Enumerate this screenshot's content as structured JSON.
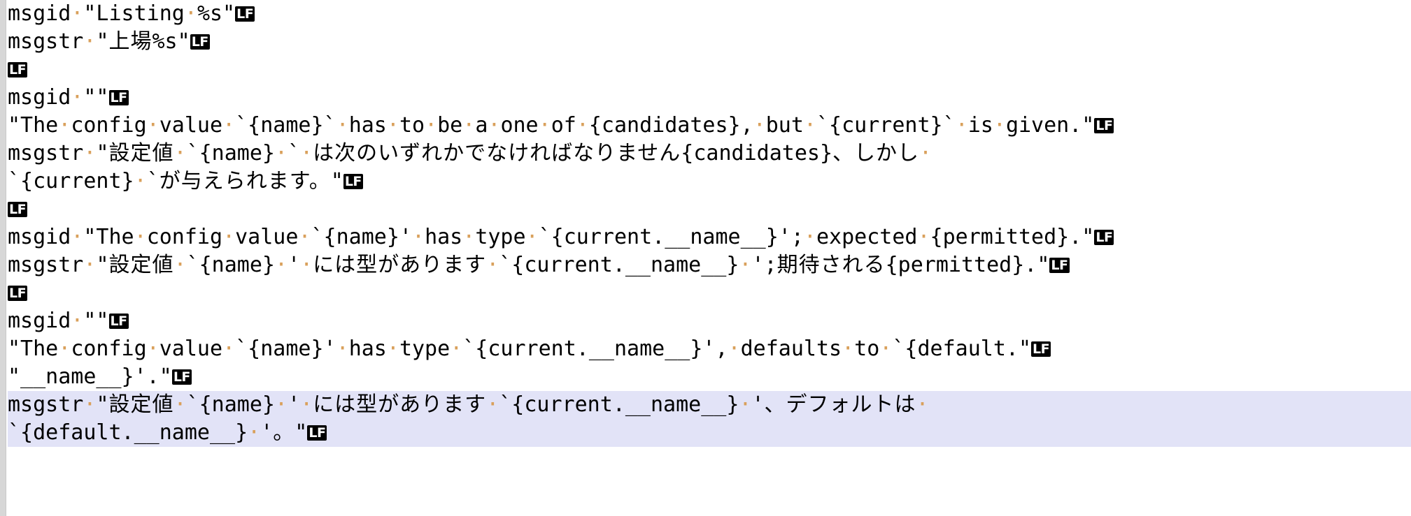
{
  "editor": {
    "file_type": "gettext-po",
    "show_whitespace": true,
    "eol_marker_label": "LF",
    "space_marker_glyph": "·",
    "selection_color": "#e2e3f7",
    "gutter_color": "#d7d7d7",
    "background_color": "#ffffff",
    "text_color": "#000000",
    "whitespace_dot_color": "#d9a05b",
    "eol_badge_bg": "#000000",
    "eol_badge_fg": "#ffffff"
  },
  "lines": [
    {
      "id": 1,
      "selected": false,
      "eol": "LF",
      "text": "msgid \"Listing %s\"",
      "segments": [
        {
          "type": "text",
          "value": "msgid"
        },
        {
          "type": "space"
        },
        {
          "type": "text",
          "value": "\"Listing"
        },
        {
          "type": "space"
        },
        {
          "type": "text",
          "value": "%s\""
        }
      ]
    },
    {
      "id": 2,
      "selected": false,
      "eol": "LF",
      "text": "msgstr \"上場%s\"",
      "segments": [
        {
          "type": "text",
          "value": "msgstr"
        },
        {
          "type": "space"
        },
        {
          "type": "text",
          "value": "\""
        },
        {
          "type": "jp",
          "value": "上場"
        },
        {
          "type": "text",
          "value": "%s\""
        }
      ]
    },
    {
      "id": 3,
      "selected": false,
      "eol": "LF",
      "text": "",
      "segments": []
    },
    {
      "id": 4,
      "selected": false,
      "eol": "LF",
      "text": "msgid \"\"",
      "segments": [
        {
          "type": "text",
          "value": "msgid"
        },
        {
          "type": "space"
        },
        {
          "type": "text",
          "value": "\"\""
        }
      ]
    },
    {
      "id": 5,
      "selected": false,
      "eol": "LF",
      "text": "\"The config value `{name}` has to be a one of {candidates}, but `{current}` is given.\"",
      "segments": [
        {
          "type": "text",
          "value": "\"The"
        },
        {
          "type": "space"
        },
        {
          "type": "text",
          "value": "config"
        },
        {
          "type": "space"
        },
        {
          "type": "text",
          "value": "value"
        },
        {
          "type": "space"
        },
        {
          "type": "text",
          "value": "`{name}`"
        },
        {
          "type": "space"
        },
        {
          "type": "text",
          "value": "has"
        },
        {
          "type": "space"
        },
        {
          "type": "text",
          "value": "to"
        },
        {
          "type": "space"
        },
        {
          "type": "text",
          "value": "be"
        },
        {
          "type": "space"
        },
        {
          "type": "text",
          "value": "a"
        },
        {
          "type": "space"
        },
        {
          "type": "text",
          "value": "one"
        },
        {
          "type": "space"
        },
        {
          "type": "text",
          "value": "of"
        },
        {
          "type": "space"
        },
        {
          "type": "text",
          "value": "{candidates},"
        },
        {
          "type": "space"
        },
        {
          "type": "text",
          "value": "but"
        },
        {
          "type": "space"
        },
        {
          "type": "text",
          "value": "`{current}`"
        },
        {
          "type": "space"
        },
        {
          "type": "text",
          "value": "is"
        },
        {
          "type": "space"
        },
        {
          "type": "text",
          "value": "given.\""
        }
      ]
    },
    {
      "id": 6,
      "selected": false,
      "eol": "",
      "text": "msgstr \"設定値 `{name}` は次のいずれかでなければなりません{candidates}、しかし ",
      "segments": [
        {
          "type": "text",
          "value": "msgstr"
        },
        {
          "type": "space"
        },
        {
          "type": "text",
          "value": "\""
        },
        {
          "type": "jp",
          "value": "設定値"
        },
        {
          "type": "space"
        },
        {
          "type": "text",
          "value": "`{name}"
        },
        {
          "type": "space"
        },
        {
          "type": "text",
          "value": "`"
        },
        {
          "type": "space"
        },
        {
          "type": "jp",
          "value": "は次のいずれかでなければなりません"
        },
        {
          "type": "text",
          "value": "{candidates}"
        },
        {
          "type": "jp",
          "value": "、しかし"
        },
        {
          "type": "space"
        }
      ]
    },
    {
      "id": 7,
      "selected": false,
      "eol": "LF",
      "text": "`{current} `が与えられます。\"",
      "segments": [
        {
          "type": "text",
          "value": "`{current}"
        },
        {
          "type": "space"
        },
        {
          "type": "text",
          "value": "`"
        },
        {
          "type": "jp",
          "value": "が与えられます。"
        },
        {
          "type": "text",
          "value": "\""
        }
      ]
    },
    {
      "id": 8,
      "selected": false,
      "eol": "LF",
      "text": "",
      "segments": []
    },
    {
      "id": 9,
      "selected": false,
      "eol": "LF",
      "text": "msgid \"The config value `{name}' has type `{current.__name__}'; expected {permitted}.\"",
      "segments": [
        {
          "type": "text",
          "value": "msgid"
        },
        {
          "type": "space"
        },
        {
          "type": "text",
          "value": "\"The"
        },
        {
          "type": "space"
        },
        {
          "type": "text",
          "value": "config"
        },
        {
          "type": "space"
        },
        {
          "type": "text",
          "value": "value"
        },
        {
          "type": "space"
        },
        {
          "type": "text",
          "value": "`{name}'"
        },
        {
          "type": "space"
        },
        {
          "type": "text",
          "value": "has"
        },
        {
          "type": "space"
        },
        {
          "type": "text",
          "value": "type"
        },
        {
          "type": "space"
        },
        {
          "type": "text",
          "value": "`{current.__name__}';"
        },
        {
          "type": "space"
        },
        {
          "type": "text",
          "value": "expected"
        },
        {
          "type": "space"
        },
        {
          "type": "text",
          "value": "{permitted}.\""
        }
      ]
    },
    {
      "id": 10,
      "selected": false,
      "eol": "LF",
      "text": "msgstr \"設定値 `{name} ' には型があります `{current.__name__} ';期待される{permitted}.\"",
      "segments": [
        {
          "type": "text",
          "value": "msgstr"
        },
        {
          "type": "space"
        },
        {
          "type": "text",
          "value": "\""
        },
        {
          "type": "jp",
          "value": "設定値"
        },
        {
          "type": "space"
        },
        {
          "type": "text",
          "value": "`{name}"
        },
        {
          "type": "space"
        },
        {
          "type": "text",
          "value": "'"
        },
        {
          "type": "space"
        },
        {
          "type": "jp",
          "value": "には型があります"
        },
        {
          "type": "space"
        },
        {
          "type": "text",
          "value": "`{current.__name__}"
        },
        {
          "type": "space"
        },
        {
          "type": "text",
          "value": "';"
        },
        {
          "type": "jp",
          "value": "期待される"
        },
        {
          "type": "text",
          "value": "{permitted}.\""
        }
      ]
    },
    {
      "id": 11,
      "selected": false,
      "eol": "LF",
      "text": "",
      "segments": []
    },
    {
      "id": 12,
      "selected": false,
      "eol": "LF",
      "text": "msgid \"\"",
      "segments": [
        {
          "type": "text",
          "value": "msgid"
        },
        {
          "type": "space"
        },
        {
          "type": "text",
          "value": "\"\""
        }
      ]
    },
    {
      "id": 13,
      "selected": false,
      "eol": "LF",
      "text": "\"The config value `{name}' has type `{current.__name__}', defaults to `{default.\"",
      "segments": [
        {
          "type": "text",
          "value": "\"The"
        },
        {
          "type": "space"
        },
        {
          "type": "text",
          "value": "config"
        },
        {
          "type": "space"
        },
        {
          "type": "text",
          "value": "value"
        },
        {
          "type": "space"
        },
        {
          "type": "text",
          "value": "`{name}'"
        },
        {
          "type": "space"
        },
        {
          "type": "text",
          "value": "has"
        },
        {
          "type": "space"
        },
        {
          "type": "text",
          "value": "type"
        },
        {
          "type": "space"
        },
        {
          "type": "text",
          "value": "`{current.__name__}',"
        },
        {
          "type": "space"
        },
        {
          "type": "text",
          "value": "defaults"
        },
        {
          "type": "space"
        },
        {
          "type": "text",
          "value": "to"
        },
        {
          "type": "space"
        },
        {
          "type": "text",
          "value": "`{default.\""
        }
      ]
    },
    {
      "id": 14,
      "selected": false,
      "eol": "LF",
      "text": "\"__name__}'.\"",
      "segments": [
        {
          "type": "text",
          "value": "\"__name__}'.\""
        }
      ]
    },
    {
      "id": 15,
      "selected": true,
      "eol": "",
      "text": "msgstr \"設定値 `{name} ' には型があります `{current.__name__} '、デフォルトは ",
      "segments": [
        {
          "type": "text",
          "value": "msgstr"
        },
        {
          "type": "space"
        },
        {
          "type": "text",
          "value": "\""
        },
        {
          "type": "jp",
          "value": "設定値"
        },
        {
          "type": "space"
        },
        {
          "type": "text",
          "value": "`{name}"
        },
        {
          "type": "space"
        },
        {
          "type": "text",
          "value": "'"
        },
        {
          "type": "space"
        },
        {
          "type": "jp",
          "value": "には型があります"
        },
        {
          "type": "space"
        },
        {
          "type": "text",
          "value": "`{current.__name__}"
        },
        {
          "type": "space"
        },
        {
          "type": "text",
          "value": "'"
        },
        {
          "type": "jp",
          "value": "、デフォルトは"
        },
        {
          "type": "space"
        }
      ]
    },
    {
      "id": 16,
      "selected": true,
      "eol": "LF",
      "text": "`{default.__name__} '。\"",
      "segments": [
        {
          "type": "text",
          "value": "`{default.__name__}"
        },
        {
          "type": "space"
        },
        {
          "type": "text",
          "value": "'"
        },
        {
          "type": "jp",
          "value": "。"
        },
        {
          "type": "text",
          "value": "\""
        }
      ]
    }
  ]
}
